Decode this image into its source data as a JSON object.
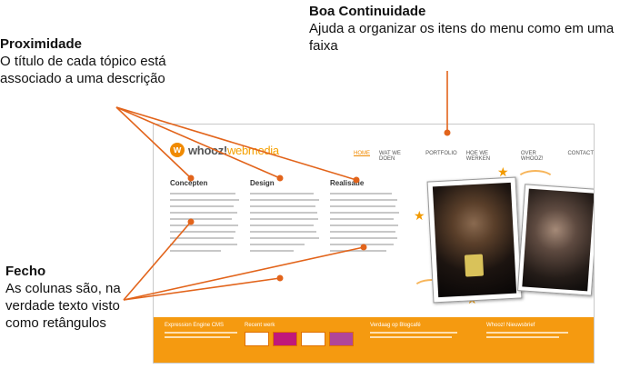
{
  "annotations": {
    "top": {
      "title": "Boa Continuidade",
      "text": "Ajuda a organizar os itens do menu como em uma faixa"
    },
    "proximidade": {
      "title": "Proximidade",
      "text": "O título de cada tópico está associado a uma descrição"
    },
    "fecho": {
      "title": "Fecho",
      "text": "As colunas são, na verdade texto visto como retângulos"
    }
  },
  "site": {
    "logo": "whooz!",
    "logo_sub": "webmedia",
    "nav": [
      "HOME",
      "WAT WE DOEN",
      "PORTFOLIO",
      "HOE WE WERKEN",
      "OVER WHOOZ!",
      "CONTACT"
    ],
    "columns": [
      {
        "title": "Concepten"
      },
      {
        "title": "Design"
      },
      {
        "title": "Realisatie"
      }
    ],
    "footer": [
      {
        "title": "Expression Engine CMS"
      },
      {
        "title": "Recent werk"
      },
      {
        "title": "Verdaag op Blogcafé"
      },
      {
        "title": "Whooz! Nieuwsbrief"
      }
    ]
  },
  "colors": {
    "accent": "#f08a00",
    "footer": "#f59a10",
    "arrow": "#e2641b"
  }
}
